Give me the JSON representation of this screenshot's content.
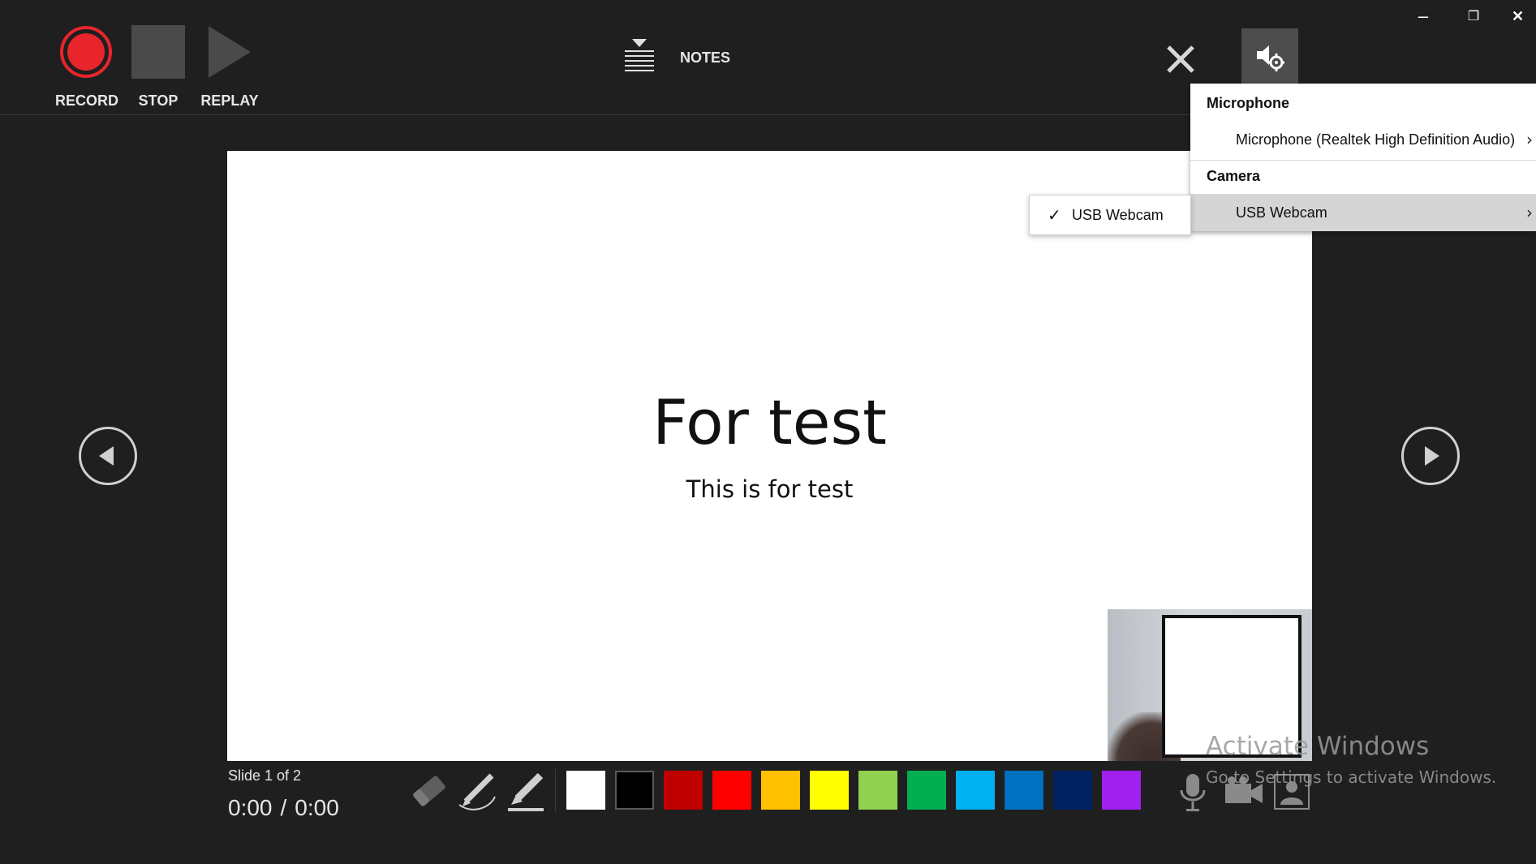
{
  "window": {
    "minimize_glyph": "–",
    "restore_glyph": "❐",
    "close_glyph": "✕"
  },
  "toolbar": {
    "record_label": "RECORD",
    "stop_label": "STOP",
    "replay_label": "REPLAY",
    "notes_label": "NOTES",
    "record_color": "#e8252b"
  },
  "settings_menu": {
    "microphone_header": "Microphone",
    "microphone_item": "Microphone (Realtek High Definition Audio)",
    "camera_header": "Camera",
    "camera_item": "USB Webcam",
    "chevron": "›"
  },
  "camera_submenu": {
    "check_glyph": "✓",
    "item_label": "USB Webcam"
  },
  "slide": {
    "title": "For test",
    "subtitle": "This is for test"
  },
  "status": {
    "slide_position": "Slide 1 of 2",
    "elapsed": "0:00",
    "separator": "/",
    "total": "0:00"
  },
  "pen_colors": [
    "#ffffff",
    "#000000",
    "#c00000",
    "#ff0000",
    "#ffc000",
    "#ffff00",
    "#92d050",
    "#00b050",
    "#00b0f0",
    "#0070c0",
    "#002060",
    "#a020f0"
  ],
  "icons": {
    "eraser": "eraser-icon",
    "pen": "pen-icon",
    "highlighter": "highlighter-icon",
    "microphone": "microphone-icon",
    "camera": "camera-icon",
    "camera_preview": "camera-preview-icon",
    "settings": "audio-settings-icon"
  },
  "watermark": {
    "title": "Activate Windows",
    "subtitle": "Go to Settings to activate Windows."
  }
}
